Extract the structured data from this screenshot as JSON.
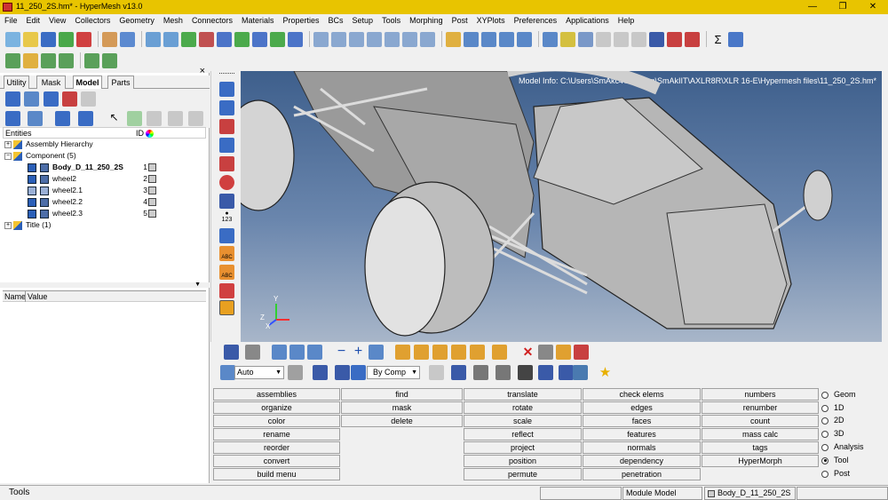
{
  "window": {
    "title": "11_250_2S.hm* - HyperMesh v13.0"
  },
  "menu": [
    "File",
    "Edit",
    "View",
    "Collectors",
    "Geometry",
    "Mesh",
    "Connectors",
    "Materials",
    "Properties",
    "BCs",
    "Setup",
    "Tools",
    "Morphing",
    "Post",
    "XYPlots",
    "Preferences",
    "Applications",
    "Help"
  ],
  "left_panel": {
    "tabs": [
      "Utility",
      "Mask",
      "Model",
      "Parts"
    ],
    "active_tab": "Model",
    "close_label": "×",
    "entities_header": "Entities",
    "id_header": "ID",
    "tree": [
      {
        "label": "Assembly Hierarchy",
        "id": "",
        "level": 0,
        "expander": "+",
        "kind": "assembly"
      },
      {
        "label": "Component (5)",
        "id": "",
        "level": 0,
        "expander": "−",
        "kind": "component"
      },
      {
        "label": "Body_D_11_250_2S",
        "id": "1",
        "level": 1,
        "bold": true,
        "kind": "comp"
      },
      {
        "label": "wheel2",
        "id": "2",
        "level": 1,
        "kind": "comp"
      },
      {
        "label": "wheel2.1",
        "id": "3",
        "level": 1,
        "kind": "comp"
      },
      {
        "label": "wheel2.2",
        "id": "4",
        "level": 1,
        "kind": "comp"
      },
      {
        "label": "wheel2.3",
        "id": "5",
        "level": 1,
        "kind": "comp"
      },
      {
        "label": "Title (1)",
        "id": "",
        "level": 0,
        "expander": "+",
        "kind": "title"
      }
    ],
    "name_value_header": {
      "name": "Name",
      "value": "Value"
    }
  },
  "viewport": {
    "model_info": "Model Info: C:\\Users\\SmAkc4\\Desktop\\SmAkIIT\\AXLR8R\\XLR 16-E\\Hypermesh files\\11_250_2S.hm*",
    "axis": {
      "x": "X",
      "y": "Y",
      "z": "Z"
    },
    "colors": {
      "sky_top": "#3e5f8c",
      "sky_bottom": "#a8b6c9",
      "part": "#b4b4b4"
    }
  },
  "vtoolbar": {
    "label_123": "123",
    "label_abc": "ABC"
  },
  "bottom_toolbar": {
    "auto_select": "Auto",
    "color_mode": "By Comp"
  },
  "panels": {
    "col1": [
      "assemblies",
      "organize",
      "color",
      "rename",
      "reorder",
      "convert",
      "build menu"
    ],
    "col2": [
      "find",
      "mask",
      "delete"
    ],
    "col3": [
      "translate",
      "rotate",
      "scale",
      "reflect",
      "project",
      "position",
      "permute"
    ],
    "col4": [
      "check elems",
      "edges",
      "faces",
      "features",
      "normals",
      "dependency",
      "penetration"
    ],
    "col5": [
      "numbers",
      "renumber",
      "count",
      "mass calc",
      "tags",
      "HyperMorph"
    ]
  },
  "page_radios": {
    "items": [
      "Geom",
      "1D",
      "2D",
      "3D",
      "Analysis",
      "Tool",
      "Post"
    ],
    "selected": "Tool"
  },
  "status_bar": {
    "left": "Tools",
    "module": "Module Model",
    "component": "Body_D_11_250_2S"
  }
}
